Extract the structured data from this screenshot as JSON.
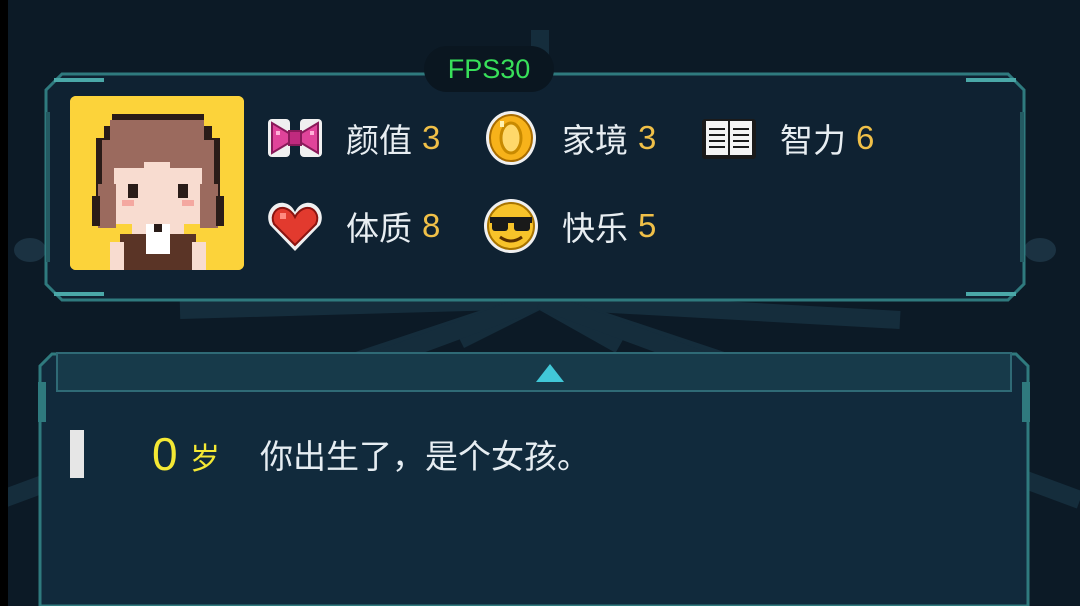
{
  "fps_label": "FPS30",
  "stats": [
    {
      "id": "appearance",
      "icon": "ribbon-icon",
      "label": "颜值",
      "value": "3"
    },
    {
      "id": "family",
      "icon": "coin-icon",
      "label": "家境",
      "value": "3"
    },
    {
      "id": "intelligence",
      "icon": "book-icon",
      "label": "智力",
      "value": "6"
    },
    {
      "id": "physique",
      "icon": "heart-icon",
      "label": "体质",
      "value": "8"
    },
    {
      "id": "happiness",
      "icon": "sunglasses-face-icon",
      "label": "快乐",
      "value": "5"
    }
  ],
  "log": {
    "age": "0",
    "age_unit": "岁",
    "event": "你出生了，是个女孩。"
  },
  "colors": {
    "background": "#0c1a26",
    "panel": "#0f2232",
    "panel_border": "#3a8a8e",
    "stat_value": "#f0c048",
    "age": "#f4e834",
    "fps": "#38e05a",
    "avatar_bg": "#fcd33a"
  }
}
